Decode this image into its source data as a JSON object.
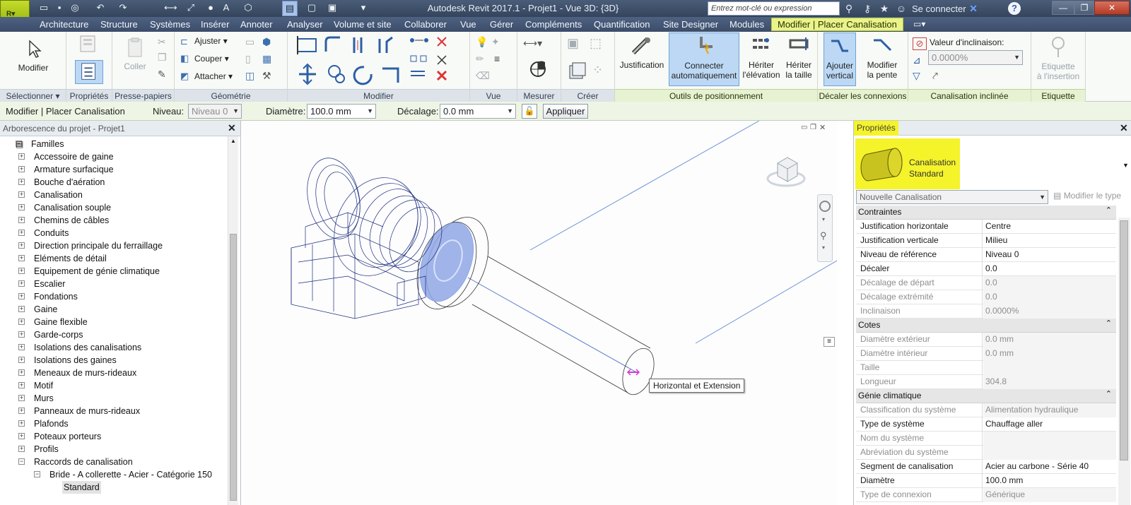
{
  "app": {
    "title": "Autodesk Revit 2017.1  -     Projet1 - Vue 3D: {3D}",
    "logo_letter": "R",
    "search_placeholder": "Entrez mot-clé ou expression",
    "sign_in": "Se connecter"
  },
  "tabs": [
    "Architecture",
    "Structure",
    "Systèmes",
    "Insérer",
    "Annoter",
    "Analyser",
    "Volume et site",
    "Collaborer",
    "Vue",
    "Gérer",
    "Compléments",
    "Quantification",
    "Site Designer",
    "Modules",
    "Modifier | Placer Canalisation"
  ],
  "ribbon": {
    "panels": {
      "select": "Sélectionner",
      "properties": "Propriétés",
      "clipboard": "Presse-papiers",
      "geometry": "Géométrie",
      "modify": "Modifier",
      "view": "Vue",
      "measure": "Mesurer",
      "create": "Créer",
      "placement": "Outils de positionnement",
      "offset": "Décaler les connexions",
      "sloped": "Canalisation inclinée",
      "tag": "Etiquette"
    },
    "buttons": {
      "modify": "Modifier",
      "paste": "Coller",
      "trim": "Ajuster",
      "cut": "Couper",
      "join": "Attacher",
      "justification": "Justification",
      "autoconnect_1": "Connecter",
      "autoconnect_2": "automatiquement",
      "inherit_elev_1": "Hériter",
      "inherit_elev_2": "l'élévation",
      "inherit_size_1": "Hériter",
      "inherit_size_2": "la taille",
      "add_vertical_1": "Ajouter",
      "add_vertical_2": "vertical",
      "change_slope_1": "Modifier",
      "change_slope_2": "la pente",
      "slope_value_label": "Valeur d'inclinaison:",
      "slope_value": "0.0000%",
      "tag_1": "Etiquette",
      "tag_2": "à l'insertion"
    }
  },
  "options_bar": {
    "context": "Modifier | Placer Canalisation",
    "level_label": "Niveau:",
    "level_value": "Niveau 0",
    "diameter_label": "Diamètre:",
    "diameter_value": "100.0 mm",
    "offset_label": "Décalage:",
    "offset_value": "0.0 mm",
    "apply": "Appliquer"
  },
  "browser": {
    "title": "Arborescence du projet - Projet1",
    "root": "Familles",
    "items": [
      "Accessoire de gaine",
      "Armature surfacique",
      "Bouche d'aération",
      "Canalisation",
      "Canalisation souple",
      "Chemins de câbles",
      "Conduits",
      "Direction principale du ferraillage",
      "Eléments de détail",
      "Equipement de génie climatique",
      "Escalier",
      "Fondations",
      "Gaine",
      "Gaine flexible",
      "Garde-corps",
      "Isolations des canalisations",
      "Isolations des gaines",
      "Meneaux de murs-rideaux",
      "Motif",
      "Murs",
      "Panneaux de murs-rideaux",
      "Plafonds",
      "Poteaux porteurs",
      "Profils",
      "Raccords de canalisation"
    ],
    "sub_item": "Bride - A collerette - Acier - Catégorie 150",
    "leaf_item": "Standard"
  },
  "viewport": {
    "tooltip": "Horizontal et Extension"
  },
  "properties": {
    "title": "Propriétés",
    "type_line1": "Canalisation",
    "type_line2": "Standard",
    "instance_selector": "Nouvelle Canalisation",
    "edit_type": "Modifier le type",
    "groups": [
      {
        "name": "Contraintes",
        "rows": [
          {
            "k": "Justification horizontale",
            "v": "Centre"
          },
          {
            "k": "Justification verticale",
            "v": "Milieu"
          },
          {
            "k": "Niveau de référence",
            "v": "Niveau 0"
          },
          {
            "k": "Décaler",
            "v": "0.0"
          },
          {
            "k": "Décalage de départ",
            "v": "0.0"
          },
          {
            "k": "Décalage extrémité",
            "v": "0.0"
          },
          {
            "k": "Inclinaison",
            "v": "0.0000%"
          }
        ]
      },
      {
        "name": "Cotes",
        "rows": [
          {
            "k": "Diamètre extérieur",
            "v": "0.0 mm"
          },
          {
            "k": "Diamètre intérieur",
            "v": "0.0 mm"
          },
          {
            "k": "Taille",
            "v": ""
          },
          {
            "k": "Longueur",
            "v": "304.8"
          }
        ]
      },
      {
        "name": "Génie climatique",
        "rows": [
          {
            "k": "Classification du système",
            "v": "Alimentation hydraulique"
          },
          {
            "k": "Type de système",
            "v": "Chauffage aller"
          },
          {
            "k": "Nom du système",
            "v": ""
          },
          {
            "k": "Abréviation du système",
            "v": ""
          },
          {
            "k": "Segment de canalisation",
            "v": "Acier au carbone - Série 40"
          },
          {
            "k": "Diamètre",
            "v": "100.0 mm"
          },
          {
            "k": "Type de connexion",
            "v": "Générique"
          }
        ]
      }
    ]
  },
  "colors": {
    "accent_yellow": "#f5f32a",
    "context_tab": "#e9f38a",
    "wire_dark": "#1c2c7c",
    "wire_light": "#8fa7e6"
  }
}
